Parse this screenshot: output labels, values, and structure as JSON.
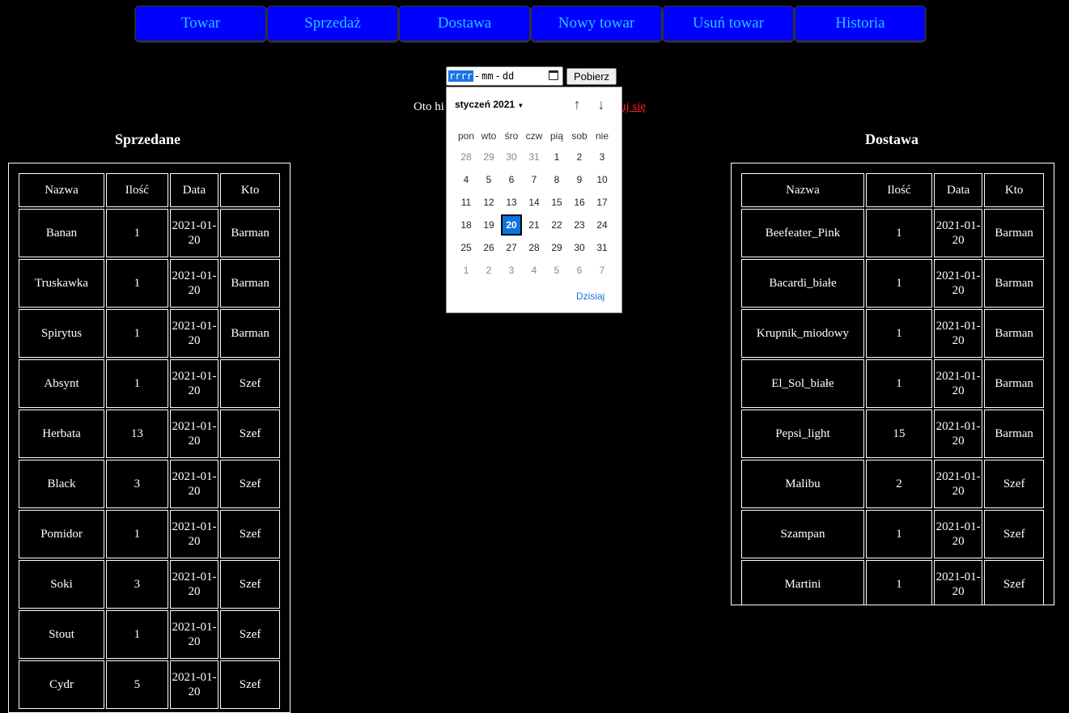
{
  "nav": [
    "Towar",
    "Sprzedaż",
    "Dostawa",
    "Nowy towar",
    "Usuń towar",
    "Historia"
  ],
  "date_form": {
    "placeholder_year": "rrrr",
    "placeholder_sep1": "-",
    "placeholder_month": "mm",
    "placeholder_sep2": "-",
    "placeholder_day": "dd",
    "submit_label": "Pobierz"
  },
  "info": {
    "text": "Oto hi",
    "link_text": "uj się"
  },
  "calendar": {
    "month_label": "styczeń 2021",
    "weekdays": [
      "pon",
      "wto",
      "śro",
      "czw",
      "pią",
      "sob",
      "nie"
    ],
    "days": [
      {
        "d": "28",
        "other": true
      },
      {
        "d": "29",
        "other": true
      },
      {
        "d": "30",
        "other": true
      },
      {
        "d": "31",
        "other": true
      },
      {
        "d": "1"
      },
      {
        "d": "2"
      },
      {
        "d": "3"
      },
      {
        "d": "4"
      },
      {
        "d": "5"
      },
      {
        "d": "6"
      },
      {
        "d": "7"
      },
      {
        "d": "8"
      },
      {
        "d": "9"
      },
      {
        "d": "10"
      },
      {
        "d": "11"
      },
      {
        "d": "12"
      },
      {
        "d": "13"
      },
      {
        "d": "14"
      },
      {
        "d": "15"
      },
      {
        "d": "16"
      },
      {
        "d": "17"
      },
      {
        "d": "18"
      },
      {
        "d": "19"
      },
      {
        "d": "20",
        "selected": true
      },
      {
        "d": "21"
      },
      {
        "d": "22"
      },
      {
        "d": "23"
      },
      {
        "d": "24"
      },
      {
        "d": "25"
      },
      {
        "d": "26"
      },
      {
        "d": "27"
      },
      {
        "d": "28"
      },
      {
        "d": "29"
      },
      {
        "d": "30"
      },
      {
        "d": "31"
      },
      {
        "d": "1",
        "other": true
      },
      {
        "d": "2",
        "other": true
      },
      {
        "d": "3",
        "other": true
      },
      {
        "d": "4",
        "other": true
      },
      {
        "d": "5",
        "other": true
      },
      {
        "d": "6",
        "other": true
      },
      {
        "d": "7",
        "other": true
      }
    ],
    "today_label": "Dzisiaj"
  },
  "sold": {
    "title": "Sprzedane",
    "headers": [
      "Nazwa",
      "Ilość",
      "Data",
      "Kto"
    ],
    "rows": [
      [
        "Banan",
        "1",
        "2021-01-20",
        "Barman"
      ],
      [
        "Truskawka",
        "1",
        "2021-01-20",
        "Barman"
      ],
      [
        "Spirytus",
        "1",
        "2021-01-20",
        "Barman"
      ],
      [
        "Absynt",
        "1",
        "2021-01-20",
        "Szef"
      ],
      [
        "Herbata",
        "13",
        "2021-01-20",
        "Szef"
      ],
      [
        "Black",
        "3",
        "2021-01-20",
        "Szef"
      ],
      [
        "Pomidor",
        "1",
        "2021-01-20",
        "Szef"
      ],
      [
        "Soki",
        "3",
        "2021-01-20",
        "Szef"
      ],
      [
        "Stout",
        "1",
        "2021-01-20",
        "Szef"
      ],
      [
        "Cydr",
        "5",
        "2021-01-20",
        "Szef"
      ]
    ]
  },
  "delivery": {
    "title": "Dostawa",
    "headers": [
      "Nazwa",
      "Ilość",
      "Data",
      "Kto"
    ],
    "rows": [
      [
        "Beefeater_Pink",
        "1",
        "2021-01-20",
        "Barman"
      ],
      [
        "Bacardi_białe",
        "1",
        "2021-01-20",
        "Barman"
      ],
      [
        "Krupnik_miodowy",
        "1",
        "2021-01-20",
        "Barman"
      ],
      [
        "El_Sol_białe",
        "1",
        "2021-01-20",
        "Barman"
      ],
      [
        "Pepsi_light",
        "15",
        "2021-01-20",
        "Barman"
      ],
      [
        "Malibu",
        "2",
        "2021-01-20",
        "Szef"
      ],
      [
        "Szampan",
        "1",
        "2021-01-20",
        "Szef"
      ],
      [
        "Martini",
        "1",
        "2021-01-20",
        "Szef"
      ]
    ]
  }
}
